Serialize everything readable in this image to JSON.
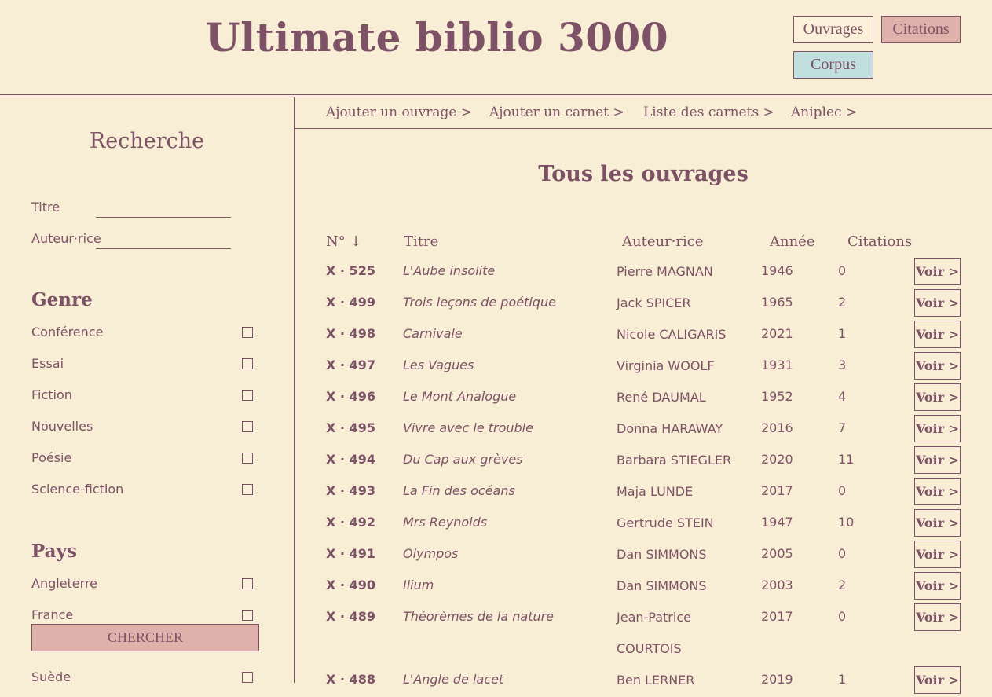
{
  "header": {
    "title": "Ultimate biblio 3000",
    "buttons": {
      "ouvrages": "Ouvrages",
      "citations": "Citations",
      "corpus": "Corpus"
    }
  },
  "sidebar": {
    "title": "Recherche",
    "fields": {
      "titre_label": "Titre",
      "auteur_label": "Auteur·rice"
    },
    "genre": {
      "title": "Genre",
      "items": [
        "Conférence",
        "Essai",
        "Fiction",
        "Nouvelles",
        "Poésie",
        "Science-fiction"
      ]
    },
    "pays": {
      "title": "Pays",
      "items": [
        "Angleterre",
        "France",
        "Suède"
      ]
    },
    "search_button": "CHERCHER"
  },
  "nav": {
    "items": [
      "Ajouter un ouvrage >",
      "Ajouter un carnet >",
      "Liste des carnets >",
      "Aniplec >"
    ]
  },
  "main": {
    "title": "Tous les ouvrages",
    "columns": {
      "num": "N° ↓",
      "titre": "Titre",
      "auteur": "Auteur·rice",
      "annee": "Année",
      "citations": "Citations"
    },
    "voir_label": "Voir >",
    "rows": [
      {
        "num": "X · 525",
        "titre": "L'Aube insolite",
        "auteur": "Pierre MAGNAN",
        "annee": "1946",
        "citations": "0"
      },
      {
        "num": "X · 499",
        "titre": "Trois leçons de poétique",
        "auteur": "Jack SPICER",
        "annee": "1965",
        "citations": "2"
      },
      {
        "num": "X · 498",
        "titre": "Carnivale",
        "auteur": "Nicole CALIGARIS",
        "annee": "2021",
        "citations": "1"
      },
      {
        "num": "X · 497",
        "titre": "Les Vagues",
        "auteur": "Virginia WOOLF",
        "annee": "1931",
        "citations": "3"
      },
      {
        "num": "X · 496",
        "titre": "Le Mont Analogue",
        "auteur": "René DAUMAL",
        "annee": "1952",
        "citations": "4"
      },
      {
        "num": "X · 495",
        "titre": "Vivre avec le trouble",
        "auteur": "Donna HARAWAY",
        "annee": "2016",
        "citations": "7"
      },
      {
        "num": "X · 494",
        "titre": "Du Cap aux grèves",
        "auteur": "Barbara STIEGLER",
        "annee": "2020",
        "citations": "11"
      },
      {
        "num": "X · 493",
        "titre": "La Fin des océans",
        "auteur": "Maja LUNDE",
        "annee": "2017",
        "citations": "0"
      },
      {
        "num": "X · 492",
        "titre": "Mrs Reynolds",
        "auteur": "Gertrude STEIN",
        "annee": "1947",
        "citations": "10"
      },
      {
        "num": "X · 491",
        "titre": "Olympos",
        "auteur": "Dan SIMMONS",
        "annee": "2005",
        "citations": "0"
      },
      {
        "num": "X · 490",
        "titre": "Ilium",
        "auteur": "Dan SIMMONS",
        "annee": "2003",
        "citations": "2"
      },
      {
        "num": "X · 489",
        "titre": "Théorèmes de la nature",
        "auteur": "Jean-Patrice COURTOIS",
        "annee": "2017",
        "citations": "0"
      },
      {
        "num": "X · 488",
        "titre": "L'Angle de lacet",
        "auteur": "Ben LERNER",
        "annee": "2019",
        "citations": "1"
      }
    ]
  }
}
